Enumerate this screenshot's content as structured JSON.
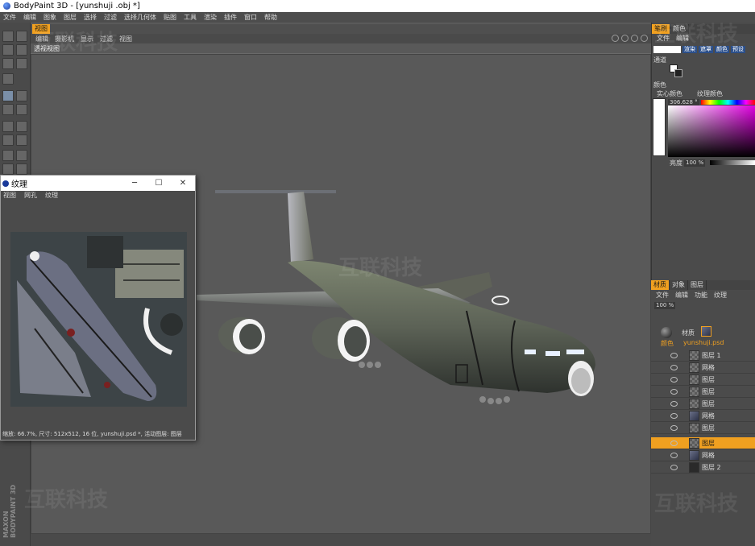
{
  "window": {
    "title": "BodyPaint 3D - [yunshuji .obj *]"
  },
  "menubar": [
    "文件",
    "编辑",
    "图象",
    "图层",
    "选择",
    "过滤",
    "选择几何体",
    "贴图",
    "工具",
    "渲染",
    "插件",
    "窗口",
    "帮助"
  ],
  "viewport": {
    "tab": "视图",
    "menu": [
      "编辑",
      "摄影机",
      "显示",
      "过滤",
      "视图"
    ],
    "label": "透视视图"
  },
  "right_panel": {
    "tabs_top": [
      "笔刷",
      "颜色"
    ],
    "menu_top": [
      "文件",
      "编辑"
    ],
    "brush_buttons": [
      "渲染",
      "遮罩",
      "颜色",
      "预设"
    ],
    "channel_label": "通道",
    "color_label": "颜色",
    "color_mode": [
      "实心颜色",
      "纹理颜色"
    ],
    "color_value_field": "306.628 °",
    "brightness_label": "亮度",
    "brightness_value": "100 %",
    "tabs_mat": [
      "材质",
      "对象",
      "图层"
    ],
    "menu_mat": [
      "文件",
      "编辑",
      "功能",
      "纹理"
    ],
    "zoom_value": "100 %",
    "material_name": "材质",
    "channel_name": "颜色",
    "texture_file": "yunshuji.psd",
    "layers": [
      "图层 1",
      "网格",
      "图层",
      "图层",
      "图层",
      "网格",
      "图层",
      "图层",
      "网格",
      "图层 2"
    ]
  },
  "texture_window": {
    "title": "纹理",
    "menu": [
      "视图",
      "网孔",
      "纹理"
    ],
    "status": "缩放: 66.7%, 尺寸: 512x512, 16 位, yunshuji.psd *, 活动图层: 图层"
  },
  "maxon_brand": "MAXON BODYPAINT 3D",
  "watermark_text": "互联科技",
  "colors": {
    "accent": "#f0a020",
    "panel": "#4b4b4b",
    "viewport": "#595959"
  }
}
